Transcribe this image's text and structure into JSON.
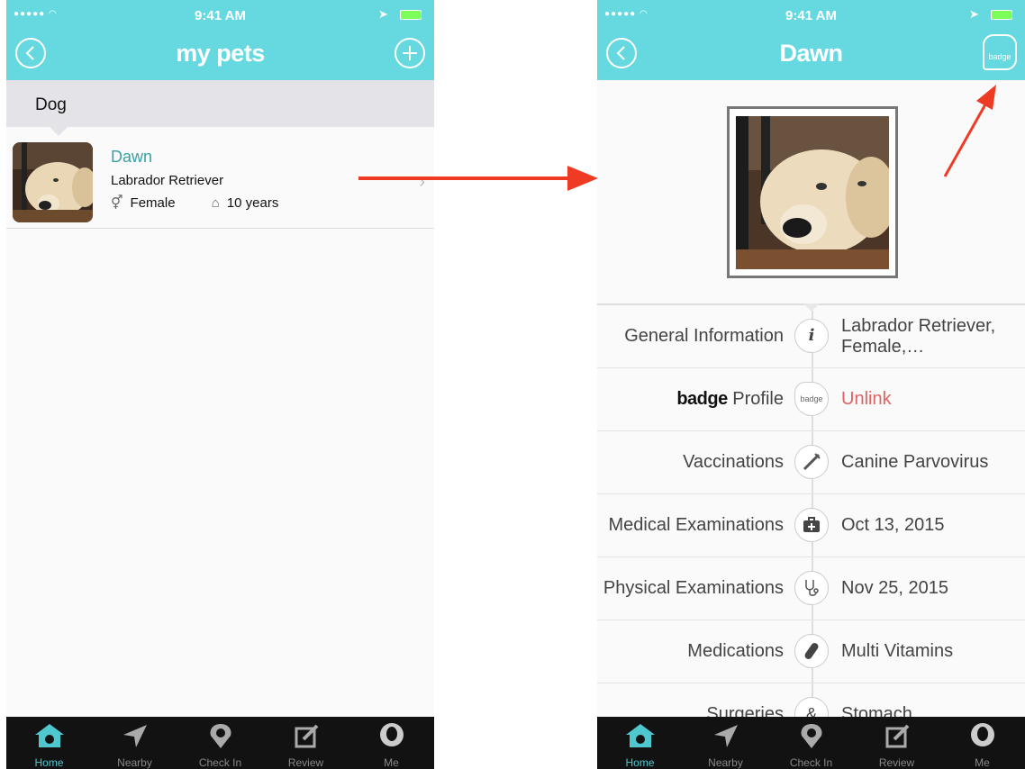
{
  "left": {
    "status": {
      "time": "9:41 AM"
    },
    "nav": {
      "title": "my pets"
    },
    "section": "Dog",
    "pet": {
      "name": "Dawn",
      "breed": "Labrador Retriever",
      "sex": "Female",
      "age": "10 years"
    }
  },
  "right": {
    "status": {
      "time": "9:41 AM"
    },
    "nav": {
      "title": "Dawn",
      "badge_button": "badge"
    },
    "rows": [
      {
        "label": "General Information",
        "value_line1": "Labrador Retriever,",
        "value_line2": "Female,…",
        "icon": "info-icon"
      },
      {
        "label_brand": "badge",
        "label": "Profile",
        "icon_text": "badge",
        "value": "Unlink",
        "icon": "badge-icon"
      },
      {
        "label": "Vaccinations",
        "value": "Canine Parvovirus",
        "icon": "syringe-icon"
      },
      {
        "label": "Medical Examinations",
        "value": "Oct 13, 2015",
        "icon": "medical-kit-icon"
      },
      {
        "label": "Physical Examinations",
        "value": "Nov 25, 2015",
        "icon": "stethoscope-icon"
      },
      {
        "label": "Medications",
        "value": "Multi Vitamins",
        "icon": "pill-icon"
      },
      {
        "label": "Surgeries",
        "value": "Stomach",
        "icon": "surgery-icon"
      }
    ]
  },
  "tabs": [
    "Home",
    "Nearby",
    "Check In",
    "Review",
    "Me"
  ],
  "colors": {
    "accent": "#66d9e0",
    "link_red": "#e06262",
    "arrow": "#ef3b24"
  }
}
